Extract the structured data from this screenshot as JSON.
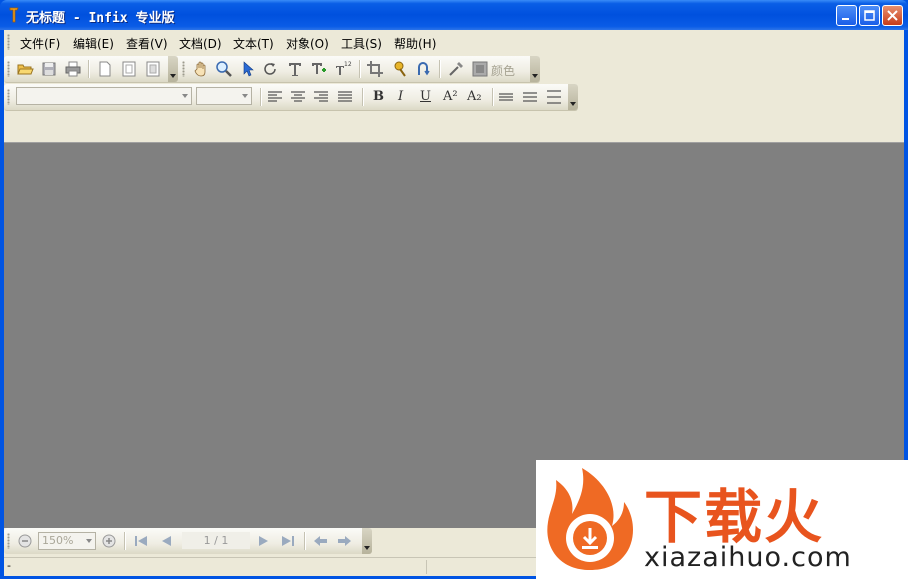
{
  "window": {
    "title": "无标题 - Infix 专业版",
    "colors": {
      "titlebar": "#0054e3",
      "client": "#ece9d8",
      "document_area": "#808080"
    }
  },
  "menubar": {
    "items": [
      {
        "label": "文件(F)"
      },
      {
        "label": "编辑(E)"
      },
      {
        "label": "查看(V)"
      },
      {
        "label": "文档(D)"
      },
      {
        "label": "文本(T)"
      },
      {
        "label": "对象(O)"
      },
      {
        "label": "工具(S)"
      },
      {
        "label": "帮助(H)"
      }
    ]
  },
  "toolbar_main": {
    "icons": [
      "open-folder-icon",
      "save-icon",
      "print-icon",
      "new-page-icon",
      "page-icon",
      "page-settings-icon",
      "hand-tool-icon",
      "zoom-tool-icon",
      "select-arrow-icon",
      "rotate-icon",
      "text-tool-icon",
      "text-add-icon",
      "text-number-icon",
      "crop-icon",
      "pin-icon",
      "link-icon",
      "eyedropper-icon",
      "color-swatch-icon"
    ],
    "color_label": "颜色"
  },
  "toolbar_format": {
    "font_value": "",
    "size_value": "",
    "align_icons": [
      "align-left-icon",
      "align-center-icon",
      "align-right-icon",
      "align-justify-icon"
    ],
    "bold": "B",
    "italic": "I",
    "underline": "U",
    "superscript": "A²",
    "subscript": "A₂"
  },
  "bottom_toolbar": {
    "zoom_value": "150%",
    "page_indicator": "1 / 1"
  },
  "statusbar": {
    "text": "-"
  },
  "watermark": {
    "brand": "下载火",
    "url": "xiazaihuo.com",
    "brand_color": "#e8541e"
  }
}
